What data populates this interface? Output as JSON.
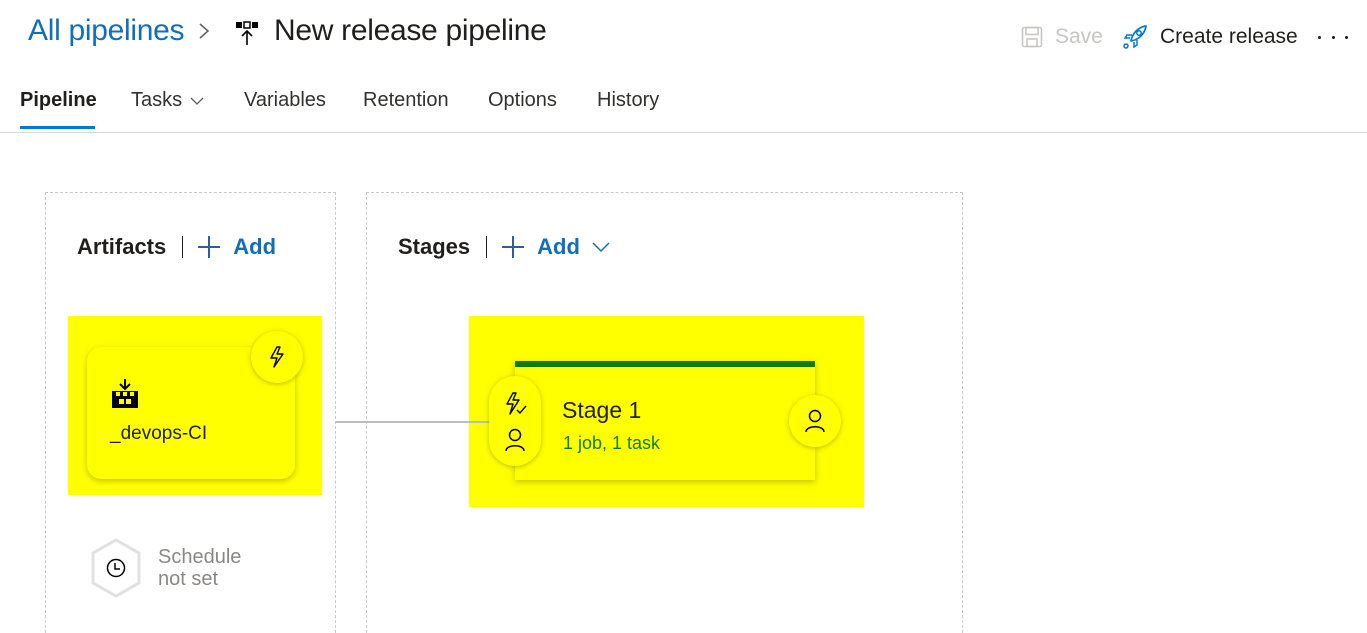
{
  "header": {
    "breadcrumb_link": "All pipelines",
    "breadcrumb_separator_icon": "chevron-right-icon",
    "pipeline_icon": "release-pipeline-icon",
    "title": "New release pipeline"
  },
  "toolbar": {
    "save_label": "Save",
    "save_enabled": false,
    "create_release_label": "Create release",
    "more_icon": "more-horizontal-icon"
  },
  "tabs": [
    {
      "label": "Pipeline",
      "active": true
    },
    {
      "label": "Tasks",
      "dropdown": true
    },
    {
      "label": "Variables"
    },
    {
      "label": "Retention"
    },
    {
      "label": "Options"
    },
    {
      "label": "History"
    }
  ],
  "artifacts": {
    "title": "Artifacts",
    "add_label": "Add",
    "items": [
      {
        "name": "_devops-CI",
        "icon": "build-artifact-icon",
        "trigger_icon": "lightning-icon"
      }
    ],
    "schedule": {
      "line1": "Schedule",
      "line2": "not set",
      "icon": "clock-icon"
    }
  },
  "stages": {
    "title": "Stages",
    "add_label": "Add",
    "items": [
      {
        "name": "Stage 1",
        "summary": "1 job, 1 task",
        "status_color": "#107c10"
      }
    ]
  },
  "colors": {
    "accent": "#0078d4",
    "link": "#106ebe",
    "highlight": "#ffff00",
    "stage_status": "#107c10"
  }
}
